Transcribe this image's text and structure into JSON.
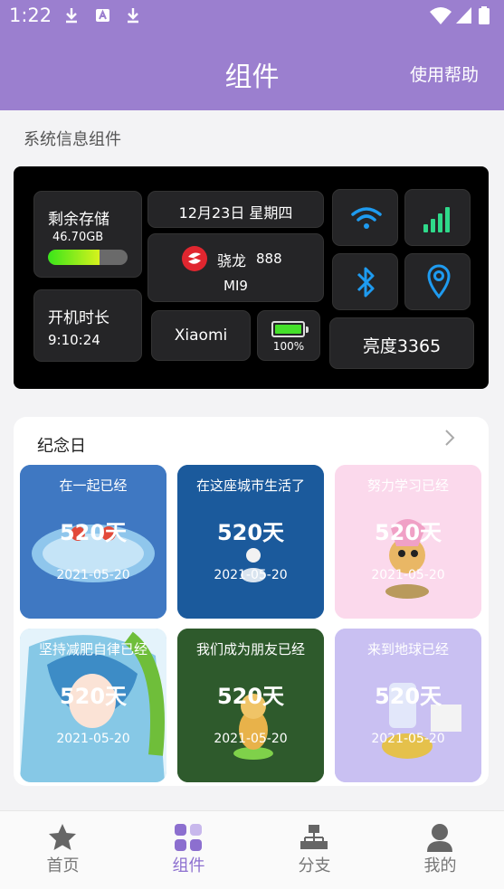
{
  "status_bar": {
    "time": "1:22",
    "icons": [
      "download-icon",
      "font-a-icon",
      "download-icon",
      "wifi-icon",
      "cell-signal-icon",
      "battery-icon"
    ]
  },
  "app_bar": {
    "title": "组件",
    "help_label": "使用帮助",
    "color": "#9b7fcf"
  },
  "system_section": {
    "title": "系统信息组件",
    "storage": {
      "label": "剩余存储",
      "value": "46.70GB",
      "used_fraction": 0.65
    },
    "uptime": {
      "label": "开机时长",
      "value": "9:10:24"
    },
    "date": "12月23日 星期四",
    "chip": {
      "brand": "骁龙",
      "model": "888",
      "device": "MI9"
    },
    "manufacturer": "Xiaomi",
    "battery": {
      "percent": "100%",
      "level": 1.0
    },
    "brightness": "亮度3365",
    "quick_icons": [
      "wifi-icon",
      "signal-bars-icon",
      "bluetooth-icon",
      "location-pin-icon"
    ],
    "accent": "#1e9bf0",
    "signal_color": "#2fd98a"
  },
  "memorial": {
    "title": "纪念日",
    "cards": [
      {
        "caption": "在一起已经",
        "days": "520天",
        "date": "2021-05-20",
        "color": "#3f78c2"
      },
      {
        "caption": "在这座城市生活了",
        "days": "520天",
        "date": "2021-05-20",
        "color": "#1b5a9c"
      },
      {
        "caption": "努力学习已经",
        "days": "520天",
        "date": "2021-05-20",
        "color": "#fbd9ec"
      },
      {
        "caption": "坚持减肥自律已经",
        "days": "520天",
        "date": "2021-05-20",
        "color": "#9fd2ea"
      },
      {
        "caption": "我们成为朋友已经",
        "days": "520天",
        "date": "2021-05-20",
        "color": "#2e5a2c"
      },
      {
        "caption": "来到地球已经",
        "days": "520天",
        "date": "2021-05-20",
        "color": "#c9c0f2"
      }
    ]
  },
  "bottom_nav": {
    "items": [
      {
        "label": "首页",
        "icon": "star-icon",
        "active": false
      },
      {
        "label": "组件",
        "icon": "grid-icon",
        "active": true
      },
      {
        "label": "分支",
        "icon": "sitemap-icon",
        "active": false
      },
      {
        "label": "我的",
        "icon": "person-icon",
        "active": false
      }
    ]
  }
}
